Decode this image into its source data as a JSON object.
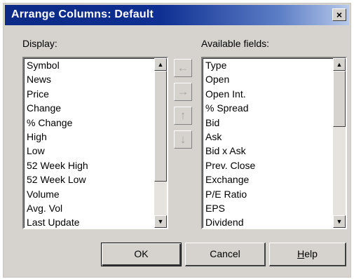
{
  "window": {
    "title": "Arrange Columns: Default",
    "close_label": "×"
  },
  "display": {
    "label": "Display:",
    "items": [
      "Symbol",
      "News",
      "Price",
      "Change",
      "% Change",
      "High",
      "Low",
      "52 Week High",
      "52 Week Low",
      "Volume",
      "Avg. Vol",
      "Last Update"
    ]
  },
  "available": {
    "label": "Available fields:",
    "items": [
      "Type",
      "Open",
      "Open Int.",
      "% Spread",
      "Bid",
      "Ask",
      "Bid x Ask",
      "Prev. Close",
      "Exchange",
      "P/E Ratio",
      "EPS",
      "Dividend"
    ]
  },
  "move_buttons": {
    "left": "←",
    "right": "→",
    "up": "↑",
    "down": "↓"
  },
  "scroll_glyphs": {
    "up": "▲",
    "down": "▼"
  },
  "buttons": {
    "ok": "OK",
    "cancel": "Cancel",
    "help_mnemonic": "H",
    "help_rest": "elp"
  }
}
